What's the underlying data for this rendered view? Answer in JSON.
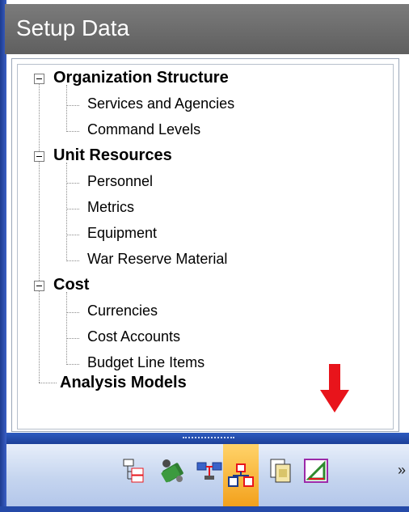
{
  "window": {
    "title": "Setup Data"
  },
  "tree": [
    {
      "label": "Organization Structure",
      "expanded": true,
      "children": [
        "Services and Agencies",
        "Command Levels"
      ]
    },
    {
      "label": "Unit Resources",
      "expanded": true,
      "children": [
        "Personnel",
        "Metrics",
        "Equipment",
        "War Reserve Material"
      ]
    },
    {
      "label": "Cost",
      "expanded": true,
      "children": [
        "Currencies",
        "Cost Accounts",
        "Budget Line Items"
      ]
    },
    {
      "label": "Analysis Models",
      "expanded": false,
      "children": []
    }
  ],
  "toolbar": {
    "buttons": [
      {
        "icon": "tree-structure-icon",
        "active": false
      },
      {
        "icon": "resources-icon",
        "active": false
      },
      {
        "icon": "network-computers-icon",
        "active": false
      },
      {
        "icon": "org-chart-icon",
        "active": true
      },
      {
        "icon": "documents-icon",
        "active": false
      },
      {
        "icon": "chart-triangle-icon",
        "active": false
      }
    ],
    "overflow_label": "»"
  },
  "colors": {
    "title_bar": "#6b6b6b",
    "arrow": "#e8141b",
    "active_button": "#f3a11c",
    "toolbar": "#c5d5ef"
  }
}
